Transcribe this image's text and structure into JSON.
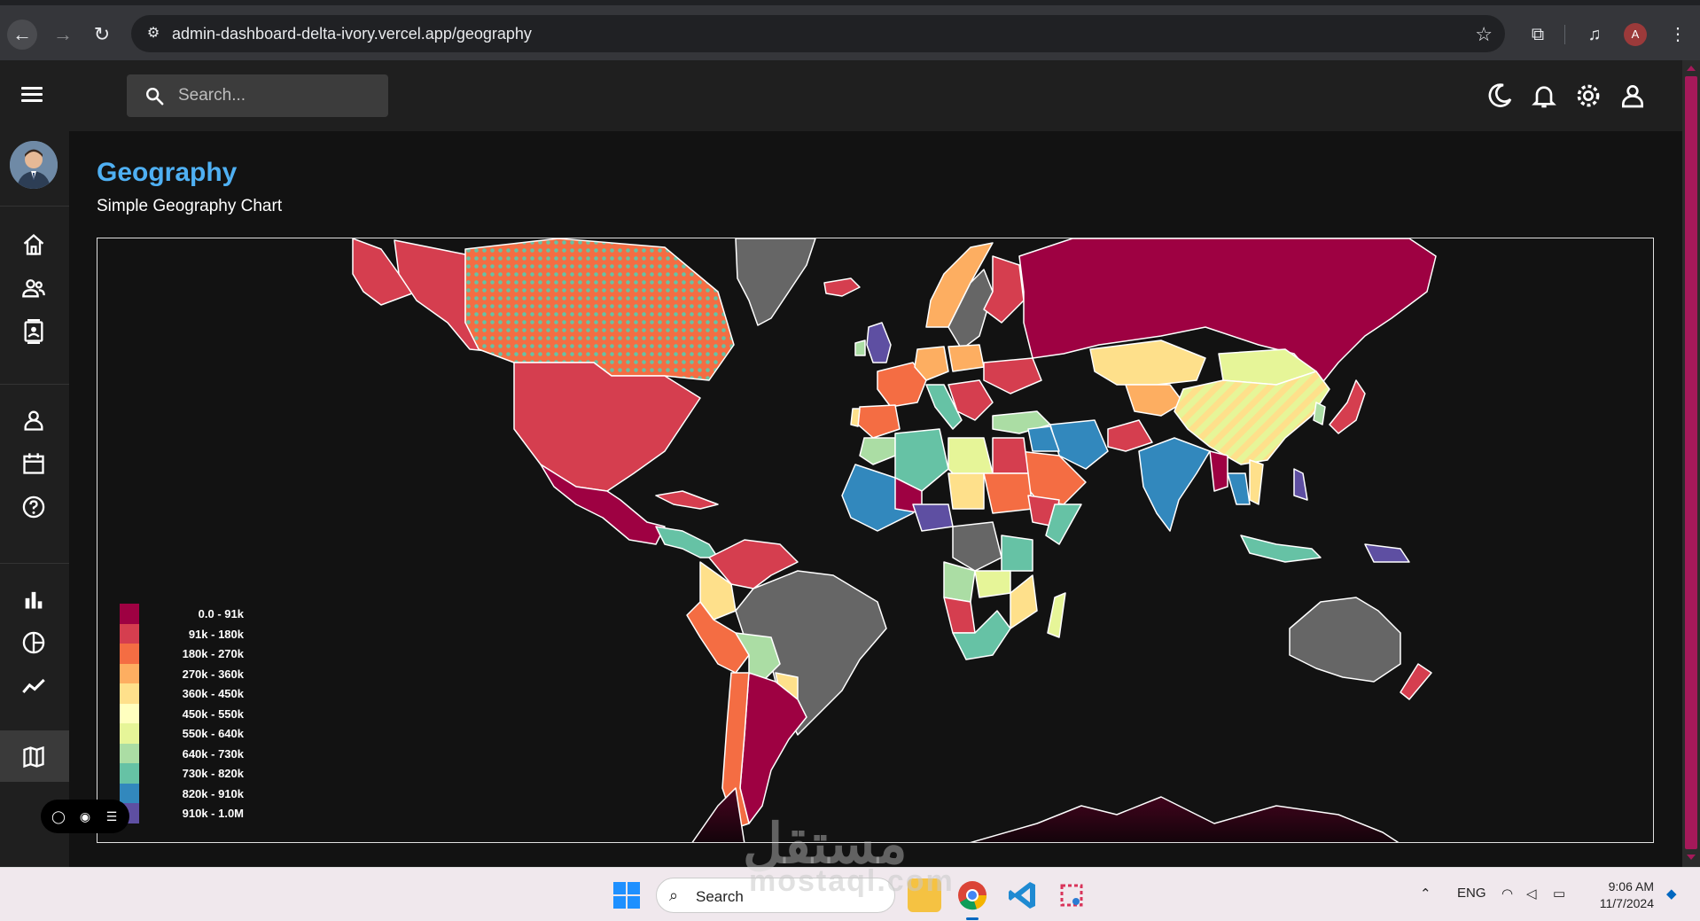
{
  "browser": {
    "url": "admin-dashboard-delta-ivory.vercel.app/geography",
    "profile_initial": "A"
  },
  "header": {
    "search_placeholder": "Search..."
  },
  "page": {
    "title": "Geography",
    "subtitle": "Simple Geography Chart"
  },
  "legend": {
    "items": [
      {
        "label": "0.0 - 91k",
        "color": "#9e0142"
      },
      {
        "label": "91k - 180k",
        "color": "#d53e4f"
      },
      {
        "label": "180k - 270k",
        "color": "#f46d43"
      },
      {
        "label": "270k - 360k",
        "color": "#fdae61"
      },
      {
        "label": "360k - 450k",
        "color": "#fee08b"
      },
      {
        "label": "450k - 550k",
        "color": "#ffffbf"
      },
      {
        "label": "550k - 640k",
        "color": "#e6f598"
      },
      {
        "label": "640k - 730k",
        "color": "#abdda4"
      },
      {
        "label": "730k - 820k",
        "color": "#66c2a5"
      },
      {
        "label": "820k - 910k",
        "color": "#3288bd"
      },
      {
        "label": "910k - 1.0M",
        "color": "#5e4fa2"
      }
    ]
  },
  "sidebar": {
    "items": [
      "home-icon",
      "contacts-icon",
      "invoices-icon",
      "profile-icon",
      "calendar-icon",
      "help-icon",
      "bar-chart-icon",
      "pie-chart-icon",
      "line-chart-icon",
      "geography-icon"
    ]
  },
  "taskbar": {
    "search_label": "Search",
    "language": "ENG",
    "time": "9:06 AM",
    "date": "11/7/2024"
  },
  "watermark": {
    "arabic": "مستقل",
    "latin": "mostaql.com"
  }
}
